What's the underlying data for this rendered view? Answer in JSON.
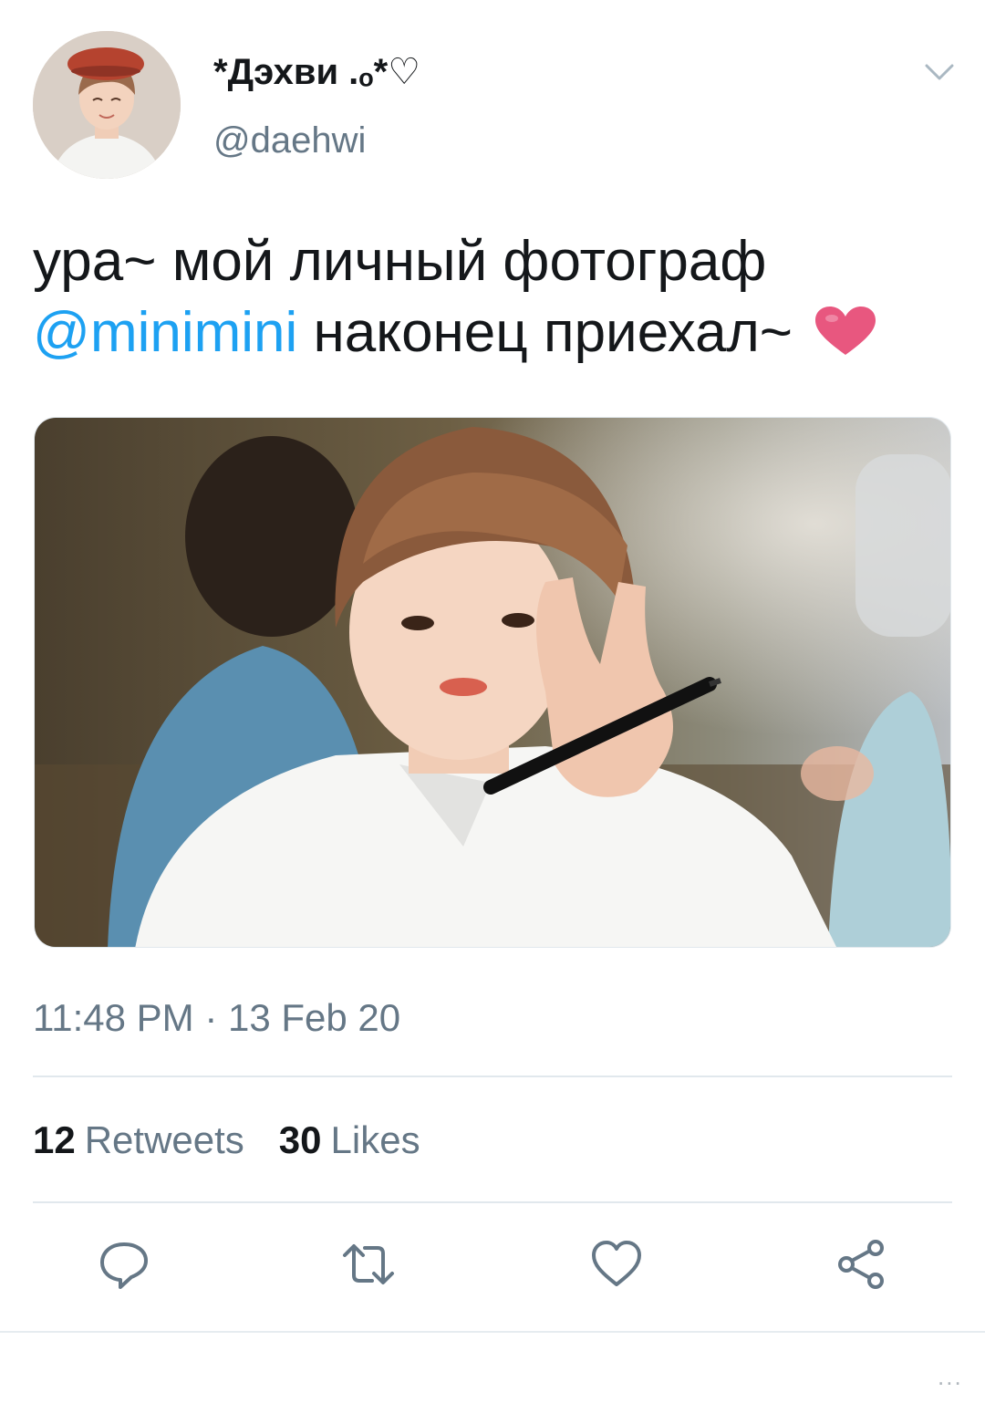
{
  "user": {
    "display_name": "*Дэхви .ₒ*♡",
    "handle": "@daehwi"
  },
  "tweet": {
    "text_line1": "ура~ мой личный фотограф",
    "mention": "@minimini",
    "text_line2": " наконец приехал~",
    "timestamp": "11:48 PM · 13 Feb 20"
  },
  "stats": {
    "retweets_count": "12",
    "retweets_label": "Retweets",
    "likes_count": "30",
    "likes_label": "Likes"
  },
  "footer": {
    "more_label": "..."
  },
  "icons": {
    "caret": "chevron-down-icon",
    "reply": "reply-icon",
    "retweet": "retweet-icon",
    "like": "like-icon",
    "share": "share-icon",
    "emoji": "heart-emoji-icon"
  },
  "colors": {
    "mention": "#1da1f2",
    "secondary_text": "#657786",
    "heart_emoji": "#e8577f",
    "divider": "#e1e8ed"
  }
}
